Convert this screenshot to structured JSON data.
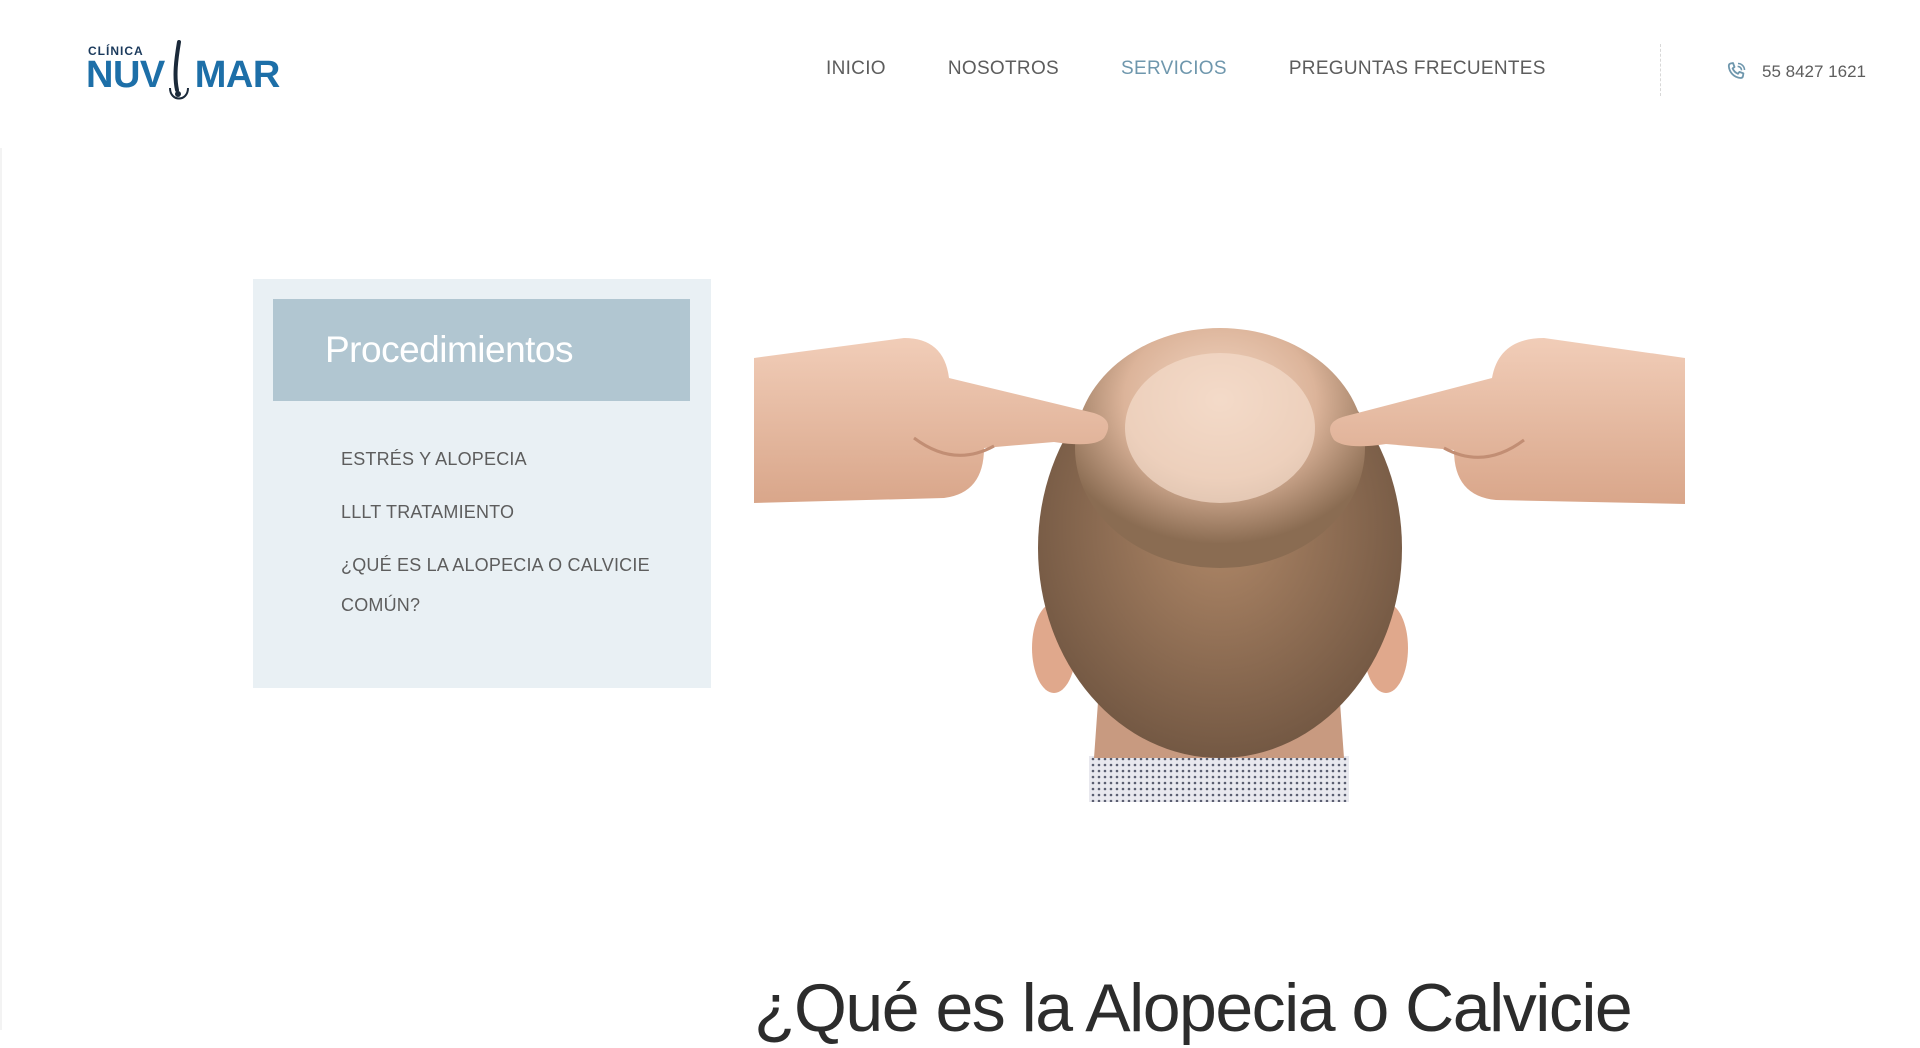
{
  "header": {
    "logo": {
      "small_text": "CLÍNICA",
      "left_text": "NUV",
      "right_text": "MAR"
    },
    "nav": [
      {
        "label": "INICIO",
        "active": false
      },
      {
        "label": "NOSOTROS",
        "active": false
      },
      {
        "label": "SERVICIOS",
        "active": true
      },
      {
        "label": "PREGUNTAS FRECUENTES",
        "active": false
      }
    ],
    "phone": {
      "icon": "phone-icon",
      "number": "55 8427 1621"
    }
  },
  "sidebar": {
    "title": "Procedimientos",
    "items": [
      {
        "label": "ESTRÉS Y ALOPECIA"
      },
      {
        "label": "LLLT TRATAMIENTO"
      },
      {
        "label": "¿QUÉ ES LA ALOPECIA O CALVICIE COMÚN?"
      }
    ]
  },
  "main": {
    "headline": "¿Qué es la Alopecia o Calvicie"
  },
  "colors": {
    "brand_blue": "#1d6fa8",
    "nav_active": "#6f97ad",
    "panel_bg": "#e9f0f4",
    "panel_header": "#b1c6d1"
  }
}
